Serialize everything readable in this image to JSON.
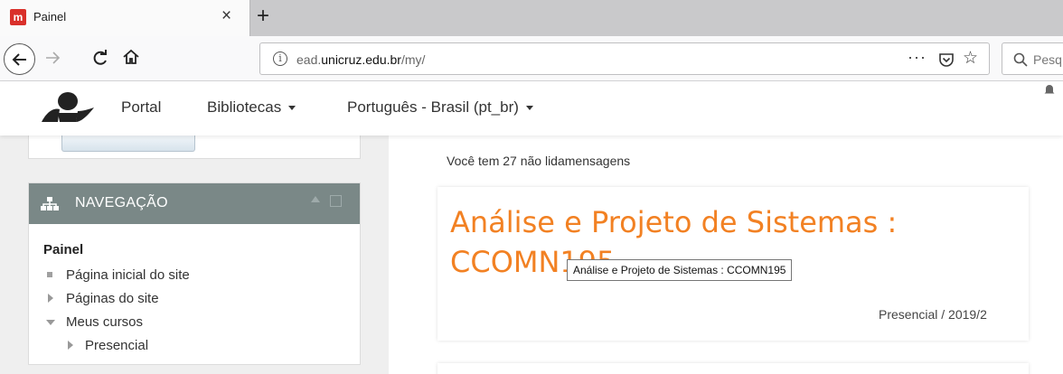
{
  "browser": {
    "tab_title": "Painel",
    "tab_favicon_letter": "m",
    "url_prefix": "ead.",
    "url_host": "unicruz.edu.br",
    "url_path": "/my/",
    "search_placeholder": "Pesq"
  },
  "header": {
    "nav": [
      {
        "label": "Portal"
      },
      {
        "label": "Bibliotecas"
      },
      {
        "label": "Português - Brasil (pt_br)"
      }
    ]
  },
  "navigation": {
    "title": "NAVEGAÇÃO",
    "root": "Painel",
    "items": [
      {
        "label": "Página inicial do site"
      },
      {
        "label": "Páginas do site"
      },
      {
        "label": "Meus cursos"
      },
      {
        "label": "Presencial"
      }
    ]
  },
  "main": {
    "messages": "Você tem 27 não lidamensagens",
    "course": {
      "title": "Análise e Projeto de Sistemas : CCOMN195",
      "category": "Presencial / 2019/2",
      "tooltip": "Análise e Projeto de Sistemas : CCOMN195"
    }
  },
  "colors": {
    "accent": "#f28123",
    "block_header": "#7a8887"
  }
}
